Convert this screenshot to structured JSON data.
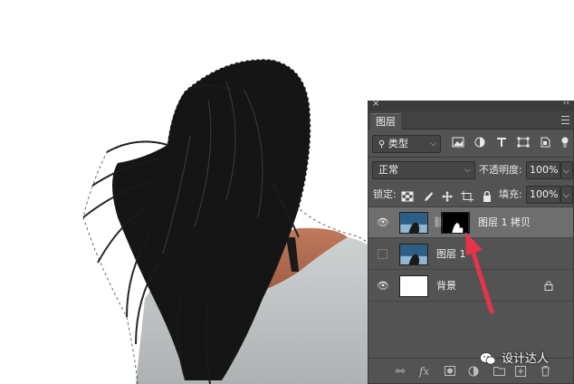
{
  "panel": {
    "close_glyph": "×",
    "collapse_glyph": "‹‹",
    "tab_label": "图层",
    "filter": {
      "label": "类型",
      "icons": [
        "image-filter-icon",
        "adjustment-filter-icon",
        "text-filter-icon",
        "shape-filter-icon",
        "smart-object-filter-icon"
      ]
    },
    "blend_mode": "正常",
    "opacity_label": "不透明度:",
    "opacity_value": "100%",
    "lock_label": "锁定:",
    "fill_label": "填充:",
    "fill_value": "100%",
    "layers": [
      {
        "name": "图层 1 拷贝",
        "visible": true,
        "selected": true,
        "has_mask": true
      },
      {
        "name": "图层 1",
        "visible": false,
        "selected": false,
        "has_mask": false
      },
      {
        "name": "背景",
        "visible": true,
        "selected": false,
        "locked": true
      }
    ],
    "footer_fx": "fx"
  },
  "watermark": {
    "text": "设计达人"
  },
  "colors": {
    "panel_bg": "#535353",
    "selected_row": "#6e6e6e",
    "arrow": "#e5344a"
  }
}
